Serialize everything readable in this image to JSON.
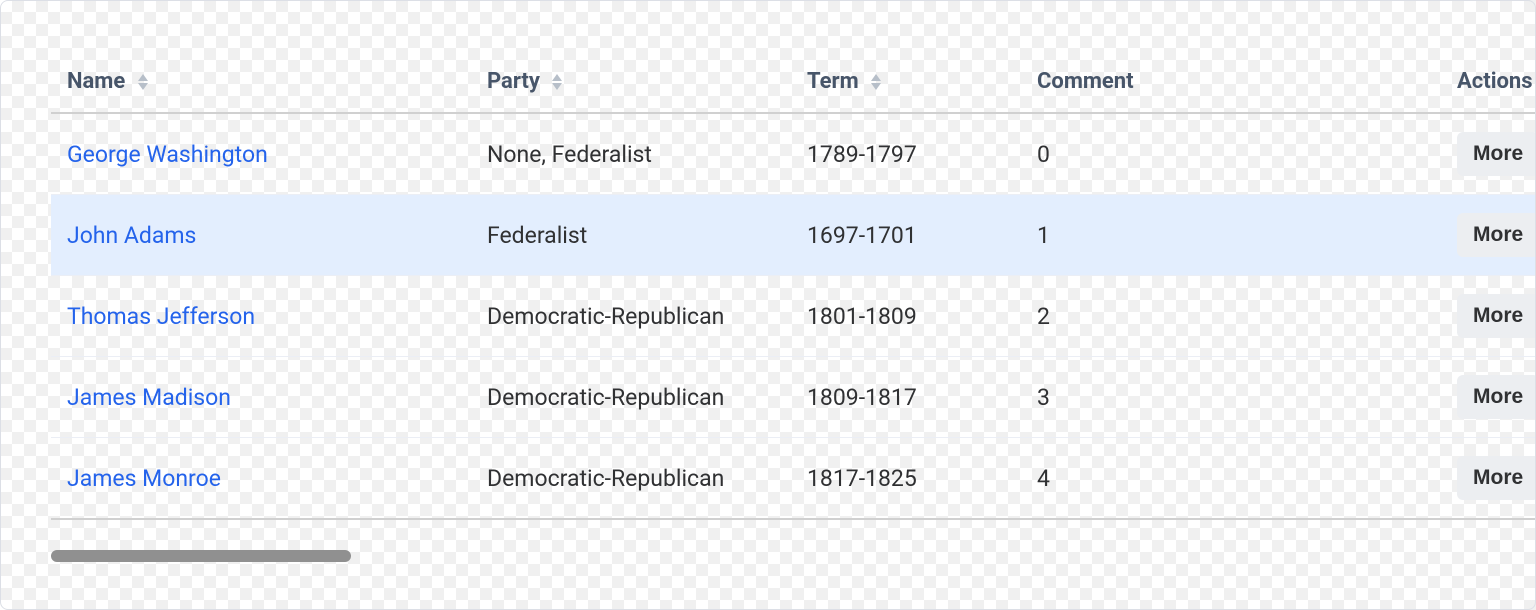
{
  "table": {
    "columns": [
      {
        "key": "name",
        "label": "Name",
        "sortable": true
      },
      {
        "key": "party",
        "label": "Party",
        "sortable": true
      },
      {
        "key": "term",
        "label": "Term",
        "sortable": true
      },
      {
        "key": "comment",
        "label": "Comment",
        "sortable": false
      },
      {
        "key": "actions",
        "label": "Actions",
        "sortable": false
      }
    ],
    "rows": [
      {
        "name": "George Washington",
        "party": "None, Federalist",
        "term": "1789-1797",
        "comment": "0",
        "action_label": "More",
        "highlight": false
      },
      {
        "name": "John Adams",
        "party": "Federalist",
        "term": "1697-1701",
        "comment": "1",
        "action_label": "More",
        "highlight": true
      },
      {
        "name": "Thomas Jefferson",
        "party": "Democratic-Republican",
        "term": "1801-1809",
        "comment": "2",
        "action_label": "More",
        "highlight": false
      },
      {
        "name": "James Madison",
        "party": "Democratic-Republican",
        "term": "1809-1817",
        "comment": "3",
        "action_label": "More",
        "highlight": false
      },
      {
        "name": "James Monroe",
        "party": "Democratic-Republican",
        "term": "1817-1825",
        "comment": "4",
        "action_label": "More",
        "highlight": false
      }
    ]
  }
}
